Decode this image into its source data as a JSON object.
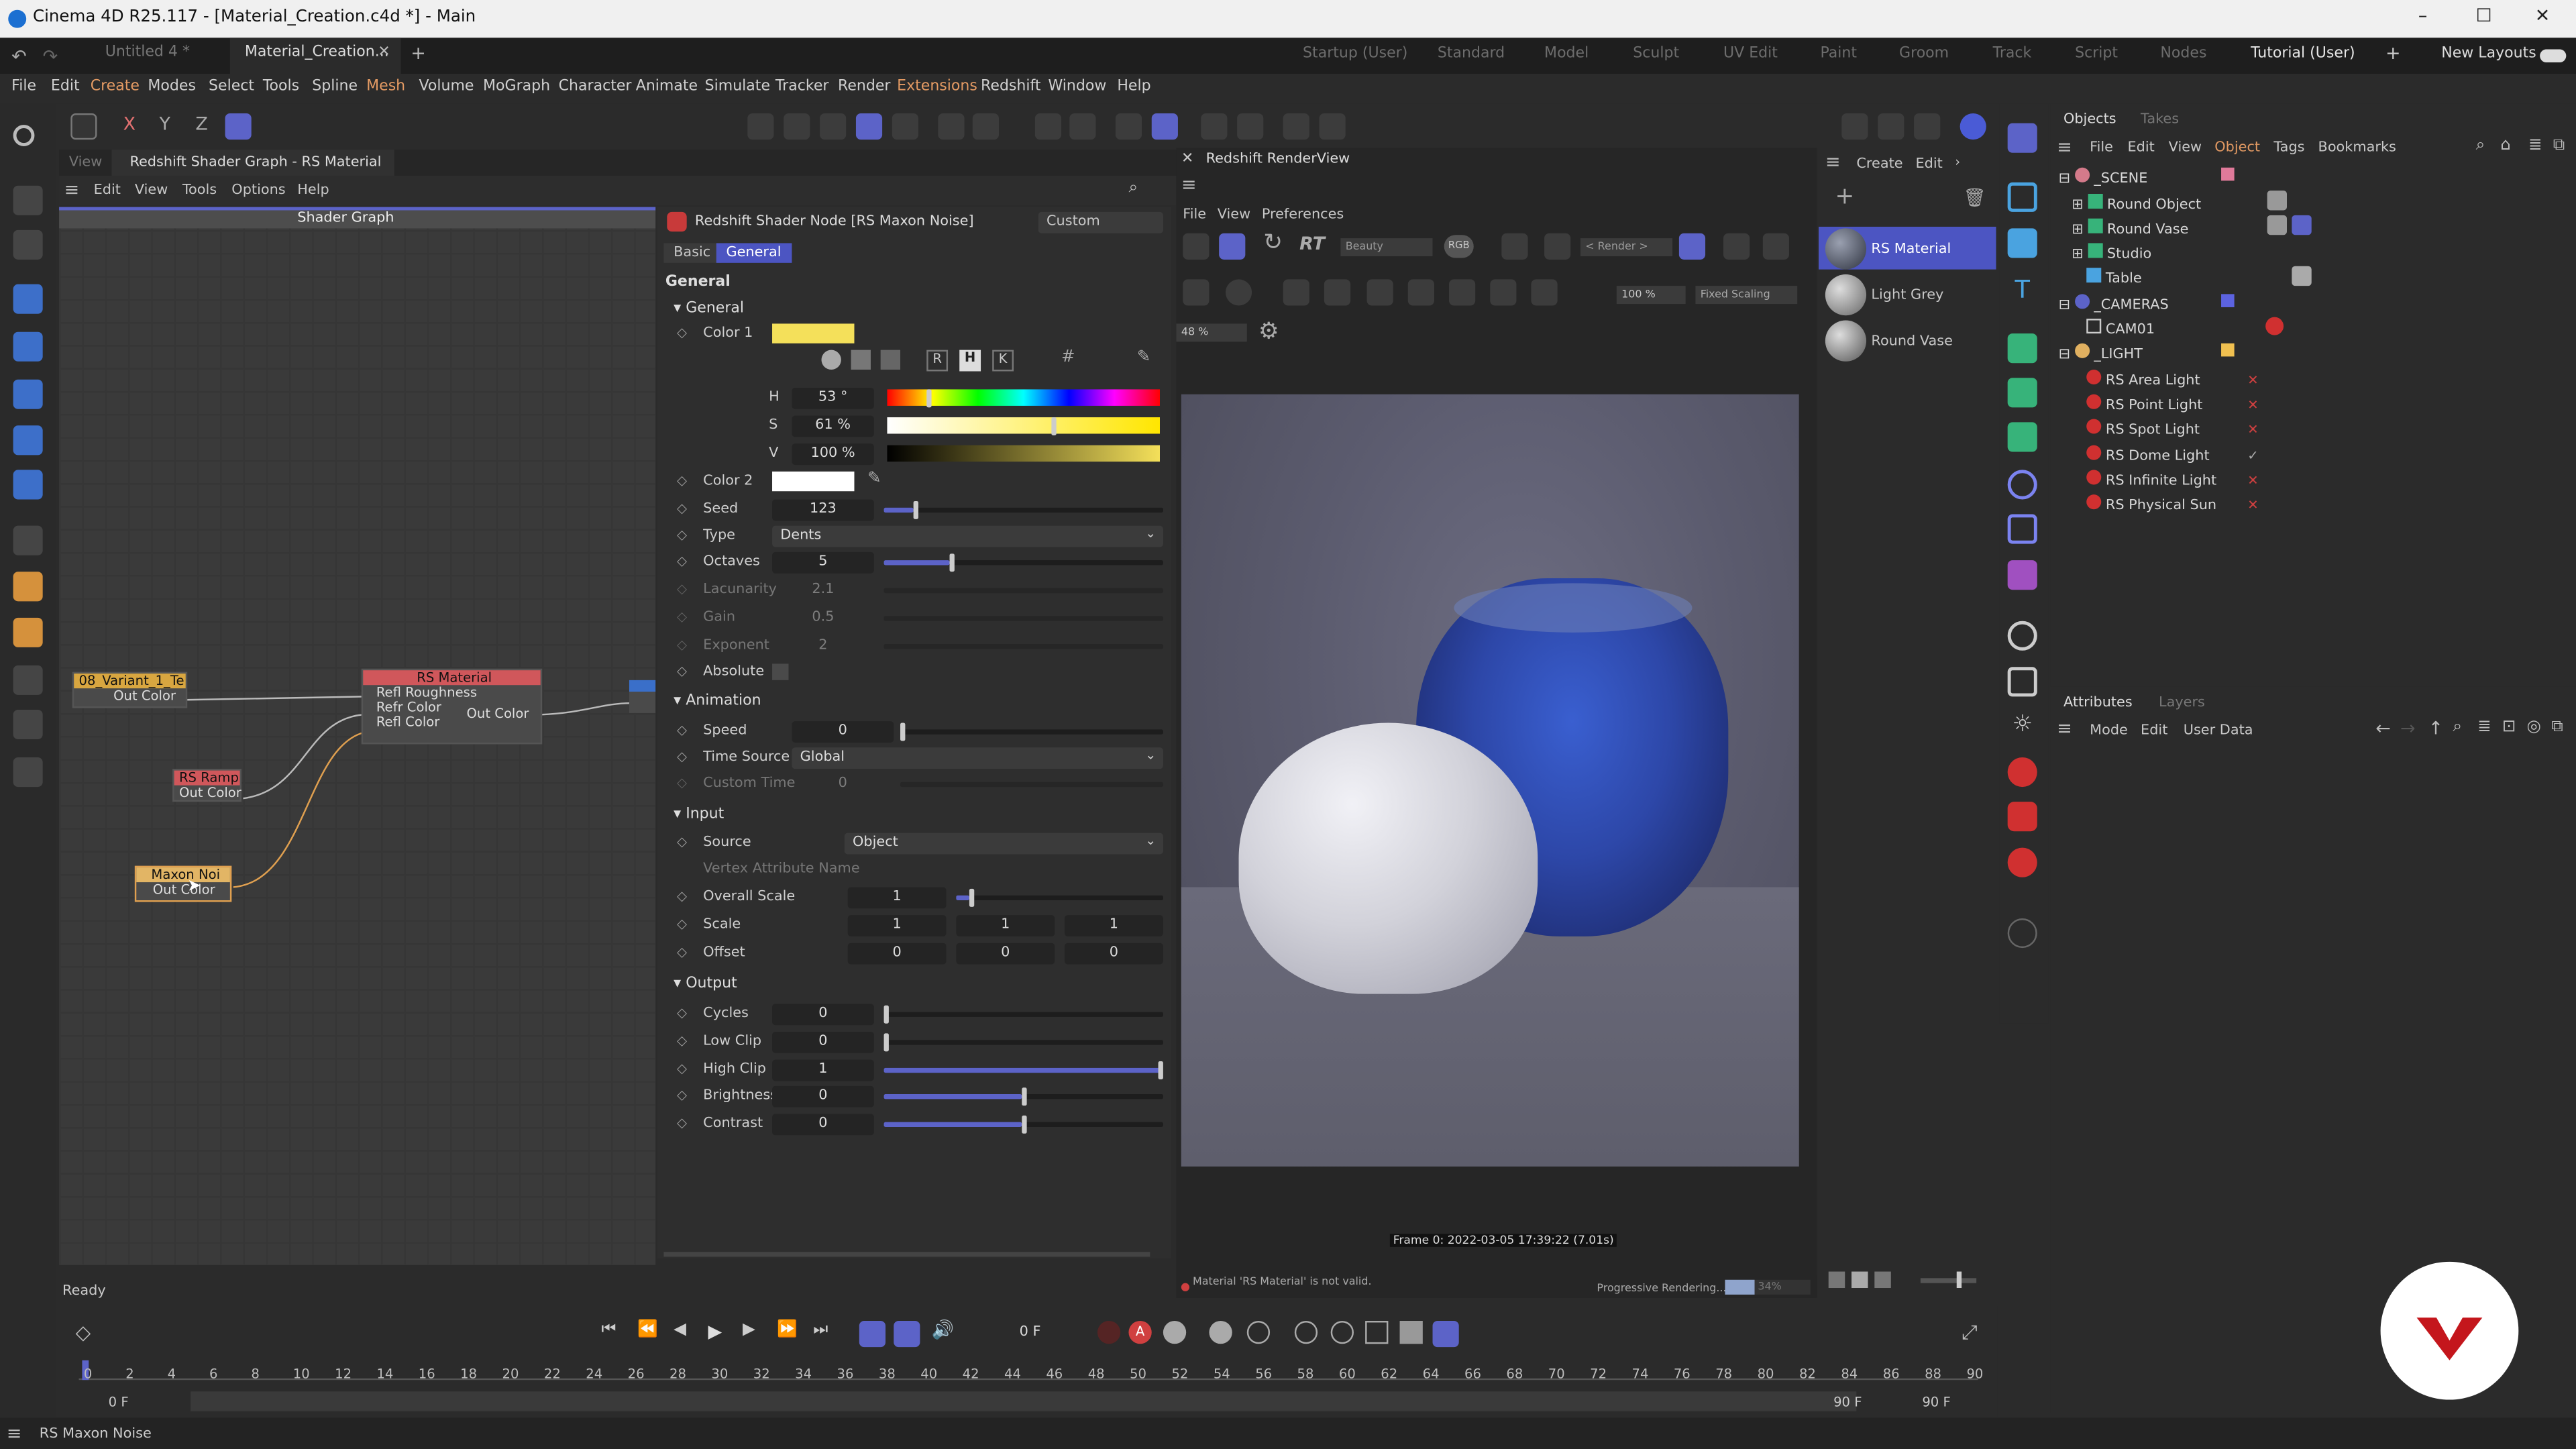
{
  "window": {
    "title": "Cinema 4D R25.117 - [Material_Creation.c4d *] - Main",
    "minimize": "–",
    "maximize": "☐",
    "close": "✕"
  },
  "doc_tabs": [
    "Untitled 4 *",
    "Material_Creation..."
  ],
  "layout_tabs": [
    "Startup (User)",
    "Standard",
    "Model",
    "Sculpt",
    "UV Edit",
    "Paint",
    "Groom",
    "Track",
    "Script",
    "Nodes",
    "Tutorial (User)",
    "New Layouts"
  ],
  "active_layout": "Tutorial (User)",
  "menus": [
    "File",
    "Edit",
    "Create",
    "Modes",
    "Select",
    "Tools",
    "Spline",
    "Mesh",
    "Volume",
    "MoGraph",
    "Character",
    "Animate",
    "Simulate",
    "Tracker",
    "Render",
    "Extensions",
    "Redshift",
    "Window",
    "Help"
  ],
  "axis_buttons": [
    "X",
    "Y",
    "Z"
  ],
  "shader_graph": {
    "tab_view": "View",
    "tab_title": "Redshift Shader Graph - RS Material",
    "menus": [
      "Edit",
      "View",
      "Tools",
      "Options",
      "Help"
    ],
    "header": "Shader Graph",
    "nodes": {
      "variant": {
        "title": "08_Variant_1_Te",
        "port": "Out Color"
      },
      "material": {
        "title": "RS Material",
        "ports": [
          "Refl Roughness",
          "Refr Color",
          "Refl Color"
        ],
        "out": "Out Color"
      },
      "ramp": {
        "title": "RS Ramp",
        "port": "Out Color"
      },
      "noise": {
        "title": "Maxon Noi",
        "port": "Out Color"
      }
    }
  },
  "attr": {
    "node_title": "Redshift Shader Node [RS Maxon Noise]",
    "preset": "Custom",
    "tabs": [
      "Basic",
      "General"
    ],
    "section": "General",
    "general": {
      "group": "General",
      "color1_label": "Color 1",
      "color1": "#f4e05a",
      "color_mode_buttons": [
        "R",
        "H",
        "K"
      ],
      "h_label": "H",
      "h_value": "53 °",
      "s_label": "S",
      "s_value": "61 %",
      "v_label": "V",
      "v_value": "100 %",
      "color2_label": "Color 2",
      "color2": "#ffffff",
      "seed_label": "Seed",
      "seed": "123",
      "type_label": "Type",
      "type": "Dents",
      "octaves_label": "Octaves",
      "octaves": "5",
      "lacunarity_label": "Lacunarity",
      "lacunarity": "2.1",
      "gain_label": "Gain",
      "gain": "0.5",
      "exponent_label": "Exponent",
      "exponent": "2",
      "absolute_label": "Absolute"
    },
    "animation": {
      "group": "Animation",
      "speed_label": "Speed",
      "speed": "0",
      "timesource_label": "Time Source",
      "timesource": "Global",
      "customtime_label": "Custom Time",
      "customtime": "0"
    },
    "input": {
      "group": "Input",
      "source_label": "Source",
      "source": "Object",
      "vertex_label": "Vertex Attribute Name",
      "overall_label": "Overall Scale",
      "overall": "1",
      "scale_label": "Scale",
      "scale": [
        "1",
        "1",
        "1"
      ],
      "offset_label": "Offset",
      "offset": [
        "0",
        "0",
        "0"
      ]
    },
    "output": {
      "group": "Output",
      "cycles_label": "Cycles",
      "cycles": "0",
      "lowclip_label": "Low Clip",
      "lowclip": "0",
      "highclip_label": "High Clip",
      "highclip": "1",
      "brightness_label": "Brightness",
      "brightness": "0",
      "contrast_label": "Contrast",
      "contrast": "0"
    }
  },
  "render": {
    "title": "Redshift RenderView",
    "menus": [
      "File",
      "View",
      "Preferences"
    ],
    "aov": "Beauty",
    "rgb": "RGB",
    "render_dd": "< Render >",
    "zoom": "100 %",
    "scaling": "Fixed Scaling",
    "zoom2": "48 %",
    "frame_info": "Frame 0:  2022-03-05  17:39:22  (7.01s)",
    "msg": "Material 'RS Material' is not valid.",
    "progress_label": "Progressive Rendering...",
    "progress": "34%"
  },
  "materials": {
    "menus": [
      "Create",
      "Edit"
    ],
    "items": [
      "RS Material",
      "Light Grey",
      "Round Vase"
    ]
  },
  "objects": {
    "tabs": [
      "Objects",
      "Takes"
    ],
    "menus": [
      "File",
      "Edit",
      "View",
      "Object",
      "Tags",
      "Bookmarks"
    ],
    "items": [
      "_SCENE",
      "Round Object",
      "Round Vase",
      "Studio",
      "Table",
      "_CAMERAS",
      "CAM01",
      "_LIGHT",
      "RS Area Light",
      "RS Point Light",
      "RS Spot Light",
      "RS Dome Light",
      "RS Infinite Light",
      "RS Physical Sun"
    ]
  },
  "attributes_mgr": {
    "tabs": [
      "Attributes",
      "Layers"
    ],
    "menus": [
      "Mode",
      "Edit",
      "User Data"
    ]
  },
  "timeline": {
    "ticks": [
      "0",
      "2",
      "4",
      "6",
      "8",
      "10",
      "12",
      "14",
      "16",
      "18",
      "20",
      "22",
      "24",
      "26",
      "28",
      "30",
      "32",
      "34",
      "36",
      "38",
      "40",
      "42",
      "44",
      "46",
      "48",
      "50",
      "52",
      "54",
      "56",
      "58",
      "60",
      "62",
      "64",
      "66",
      "68",
      "70",
      "72",
      "74",
      "76",
      "78",
      "80",
      "82",
      "84",
      "86",
      "88",
      "90"
    ],
    "frame": "0 F",
    "start": "0 F",
    "start2": "0 F",
    "end": "90 F",
    "end2": "90 F"
  },
  "status": {
    "ready": "Ready",
    "bottom": "RS Maxon Noise"
  }
}
